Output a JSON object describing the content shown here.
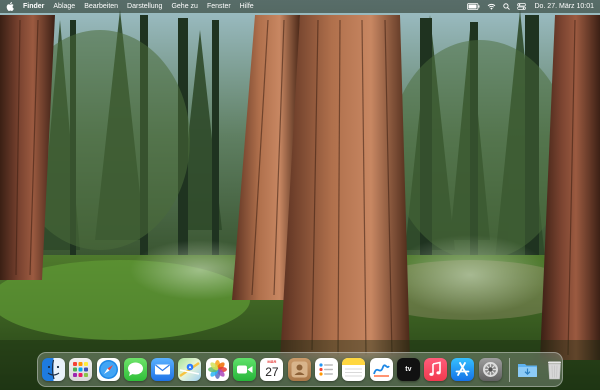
{
  "menubar": {
    "app_name": "Finder",
    "menus": [
      "Ablage",
      "Bearbeiten",
      "Darstellung",
      "Gehe zu",
      "Fenster",
      "Hilfe"
    ],
    "clock": "Do. 27. März  10:01",
    "status_icons": [
      "battery-icon",
      "wifi-icon",
      "search-icon",
      "control-center-icon"
    ]
  },
  "dock": {
    "apps": [
      "Finder",
      "Launchpad",
      "Safari",
      "Nachrichten",
      "Mail",
      "Karten",
      "Fotos",
      "FaceTime",
      "Kalender",
      "Kontakte",
      "Erinnerungen",
      "Notizen",
      "Freeform",
      "TV",
      "Musik",
      "App Store",
      "Systemeinstellungen"
    ],
    "calendar": {
      "month_short": "MÄR",
      "day": "27"
    },
    "tv_label": "tv",
    "right": [
      "Downloads",
      "Papierkorb"
    ]
  }
}
